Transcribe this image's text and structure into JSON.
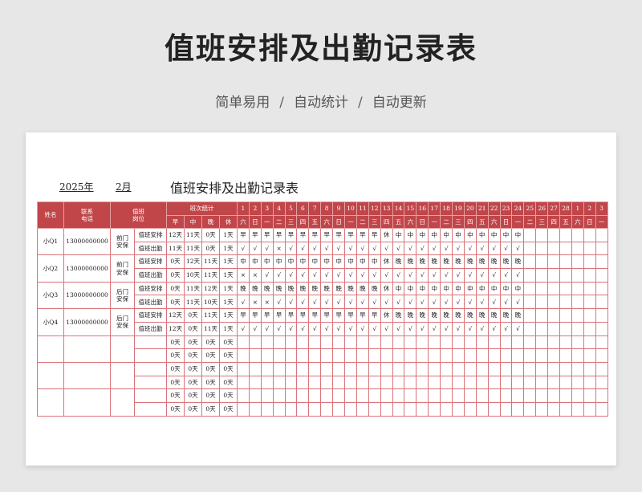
{
  "page": {
    "title": "值班安排及出勤记录表",
    "features": [
      "简单易用",
      "自动统计",
      "自动更新"
    ],
    "separator": "/"
  },
  "sheet": {
    "year": "2025年",
    "month": "2月",
    "title": "值班安排及出勤记录表"
  },
  "table": {
    "headers": {
      "name": "姓名",
      "phone": "联系\n电话",
      "post": "值班\n岗位",
      "stats": "班次统计",
      "stat_cols": [
        "早",
        "中",
        "晚",
        "休"
      ],
      "days": [
        "1",
        "2",
        "3",
        "4",
        "5",
        "6",
        "7",
        "8",
        "9",
        "10",
        "11",
        "12",
        "13",
        "14",
        "15",
        "16",
        "17",
        "18",
        "19",
        "20",
        "21",
        "22",
        "23",
        "24",
        "25",
        "26",
        "27",
        "28",
        "1",
        "2",
        "3"
      ],
      "weekdays": [
        "六",
        "日",
        "一",
        "二",
        "三",
        "四",
        "五",
        "六",
        "日",
        "一",
        "二",
        "三",
        "四",
        "五",
        "六",
        "日",
        "一",
        "二",
        "三",
        "四",
        "五",
        "六",
        "日",
        "一",
        "二",
        "三",
        "四",
        "五",
        "六",
        "日",
        "一"
      ]
    },
    "persons": [
      {
        "name": "小Q1",
        "phone": "13000000000",
        "post": "前门\n安保",
        "rows": [
          {
            "label": "值班安排",
            "stats": [
              "12天",
              "11天",
              "0天",
              "1天"
            ],
            "cells": [
              "早",
              "早",
              "早",
              "早",
              "早",
              "早",
              "早",
              "早",
              "早",
              "早",
              "早",
              "早",
              "休",
              "中",
              "中",
              "中",
              "中",
              "中",
              "中",
              "中",
              "中",
              "中",
              "中",
              "中",
              "",
              "",
              "",
              "",
              "",
              "",
              ""
            ]
          },
          {
            "label": "值班出勤",
            "stats": [
              "11天",
              "11天",
              "0天",
              "1天"
            ],
            "cells": [
              "√",
              "√",
              "√",
              "×",
              "√",
              "√",
              "√",
              "√",
              "√",
              "√",
              "√",
              "√",
              "√",
              "√",
              "√",
              "√",
              "√",
              "√",
              "√",
              "√",
              "√",
              "√",
              "√",
              "√",
              "",
              "",
              "",
              "",
              "",
              "",
              ""
            ]
          }
        ]
      },
      {
        "name": "小Q2",
        "phone": "13000000000",
        "post": "前门\n安保",
        "rows": [
          {
            "label": "值班安排",
            "stats": [
              "0天",
              "12天",
              "11天",
              "1天"
            ],
            "cells": [
              "中",
              "中",
              "中",
              "中",
              "中",
              "中",
              "中",
              "中",
              "中",
              "中",
              "中",
              "中",
              "休",
              "晚",
              "晚",
              "晚",
              "晚",
              "晚",
              "晚",
              "晚",
              "晚",
              "晚",
              "晚",
              "晚",
              "",
              "",
              "",
              "",
              "",
              "",
              ""
            ]
          },
          {
            "label": "值班出勤",
            "stats": [
              "0天",
              "10天",
              "11天",
              "1天"
            ],
            "cells": [
              "×",
              "×",
              "√",
              "√",
              "√",
              "√",
              "√",
              "√",
              "√",
              "√",
              "√",
              "√",
              "√",
              "√",
              "√",
              "√",
              "√",
              "√",
              "√",
              "√",
              "√",
              "√",
              "√",
              "√",
              "",
              "",
              "",
              "",
              "",
              "",
              ""
            ]
          }
        ]
      },
      {
        "name": "小Q3",
        "phone": "13000000000",
        "post": "后门\n安保",
        "rows": [
          {
            "label": "值班安排",
            "stats": [
              "0天",
              "11天",
              "12天",
              "1天"
            ],
            "cells": [
              "晚",
              "晚",
              "晚",
              "晚",
              "晚",
              "晚",
              "晚",
              "晚",
              "晚",
              "晚",
              "晚",
              "晚",
              "休",
              "中",
              "中",
              "中",
              "中",
              "中",
              "中",
              "中",
              "中",
              "中",
              "中",
              "中",
              "",
              "",
              "",
              "",
              "",
              "",
              ""
            ]
          },
          {
            "label": "值班出勤",
            "stats": [
              "0天",
              "11天",
              "10天",
              "1天"
            ],
            "cells": [
              "√",
              "×",
              "×",
              "√",
              "√",
              "√",
              "√",
              "√",
              "√",
              "√",
              "√",
              "√",
              "√",
              "√",
              "√",
              "√",
              "√",
              "√",
              "√",
              "√",
              "√",
              "√",
              "√",
              "√",
              "",
              "",
              "",
              "",
              "",
              "",
              ""
            ]
          }
        ]
      },
      {
        "name": "小Q4",
        "phone": "13000000000",
        "post": "后门\n安保",
        "rows": [
          {
            "label": "值班安排",
            "stats": [
              "12天",
              "0天",
              "11天",
              "1天"
            ],
            "cells": [
              "早",
              "早",
              "早",
              "早",
              "早",
              "早",
              "早",
              "早",
              "早",
              "早",
              "早",
              "早",
              "休",
              "晚",
              "晚",
              "晚",
              "晚",
              "晚",
              "晚",
              "晚",
              "晚",
              "晚",
              "晚",
              "晚",
              "",
              "",
              "",
              "",
              "",
              "",
              ""
            ]
          },
          {
            "label": "值班出勤",
            "stats": [
              "12天",
              "0天",
              "11天",
              "1天"
            ],
            "cells": [
              "√",
              "√",
              "√",
              "√",
              "√",
              "√",
              "√",
              "√",
              "√",
              "√",
              "√",
              "√",
              "√",
              "√",
              "√",
              "√",
              "√",
              "√",
              "√",
              "√",
              "√",
              "√",
              "√",
              "√",
              "",
              "",
              "",
              "",
              "",
              "",
              ""
            ]
          }
        ]
      },
      {
        "name": "",
        "phone": "",
        "post": "",
        "rows": [
          {
            "label": "",
            "stats": [
              "0天",
              "0天",
              "0天",
              "0天"
            ],
            "cells": []
          },
          {
            "label": "",
            "stats": [
              "0天",
              "0天",
              "0天",
              "0天"
            ],
            "cells": []
          }
        ]
      },
      {
        "name": "",
        "phone": "",
        "post": "",
        "rows": [
          {
            "label": "",
            "stats": [
              "0天",
              "0天",
              "0天",
              "0天"
            ],
            "cells": []
          },
          {
            "label": "",
            "stats": [
              "0天",
              "0天",
              "0天",
              "0天"
            ],
            "cells": []
          }
        ]
      },
      {
        "name": "",
        "phone": "",
        "post": "",
        "rows": [
          {
            "label": "",
            "stats": [
              "0天",
              "0天",
              "0天",
              "0天"
            ],
            "cells": []
          },
          {
            "label": "",
            "stats": [
              "0天",
              "0天",
              "0天",
              "0天"
            ],
            "cells": []
          }
        ]
      }
    ]
  }
}
